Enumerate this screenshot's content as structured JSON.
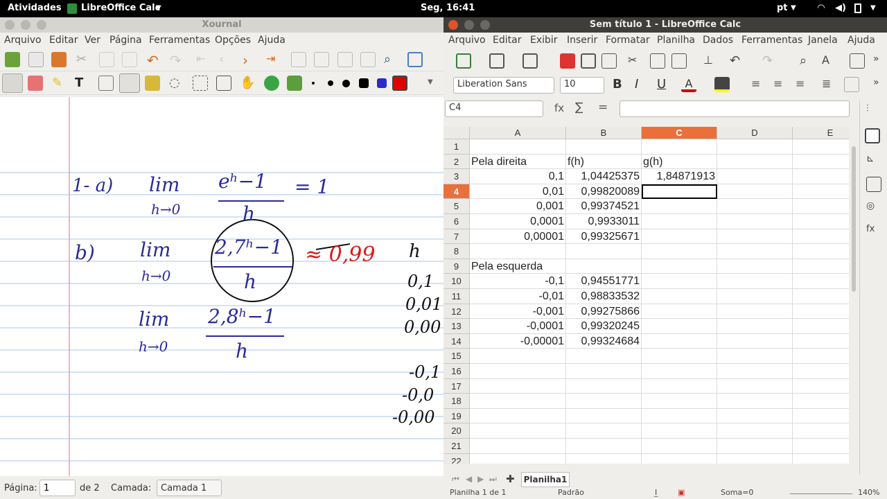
{
  "topbar": {
    "activities": "Atividades",
    "app": "LibreOffice Calc",
    "clock": "Seg, 16:41",
    "lang": "pt"
  },
  "xournal": {
    "title": "Xournal",
    "menu": [
      "Arquivo",
      "Editar",
      "Ver",
      "Página",
      "Ferramentas",
      "Opções",
      "Ajuda"
    ],
    "status": {
      "page_label": "Página:",
      "page_value": "1",
      "of_label": "de 2",
      "layer_label": "Camada:",
      "layer_value": "Camada 1"
    },
    "notes": {
      "a_label": "1- a)",
      "lim1": "lim",
      "sub1": "h→0",
      "num1": "eʰ−1",
      "den1": "h",
      "eq1": "= 1",
      "b_label": "b)",
      "lim2": "lim",
      "sub2": "h→0",
      "num2": "2,7ʰ−1",
      "den2": "h",
      "approx": "≈ 0,99",
      "lim3": "lim",
      "sub3": "h→0",
      "num3": "2,8ʰ−1",
      "den3": "h",
      "side": [
        "h",
        "0,1",
        "0,01",
        "0,00",
        "-0,1",
        "-0,0",
        "-0,00"
      ]
    }
  },
  "calc": {
    "title": "Sem título 1 - LibreOffice Calc",
    "menu": [
      "Arquivo",
      "Editar",
      "Exibir",
      "Inserir",
      "Formatar",
      "Planilha",
      "Dados",
      "Ferramentas",
      "Janela",
      "Ajuda"
    ],
    "font_name": "Liberation Sans",
    "font_size": "10",
    "name_box": "C4",
    "formula_icons": {
      "fx": "fx",
      "sum": "∑",
      "eq": "="
    },
    "columns": [
      "A",
      "B",
      "C",
      "D",
      "E"
    ],
    "rows": [
      {
        "n": "1",
        "a": "",
        "b": "",
        "c": ""
      },
      {
        "n": "2",
        "a": "Pela direita",
        "b": "f(h)",
        "c": "g(h)"
      },
      {
        "n": "3",
        "a": "0,1",
        "b": "1,04425375",
        "c": "1,84871913"
      },
      {
        "n": "4",
        "a": "0,01",
        "b": "0,99820089",
        "c": ""
      },
      {
        "n": "5",
        "a": "0,001",
        "b": "0,99374521",
        "c": ""
      },
      {
        "n": "6",
        "a": "0,0001",
        "b": "0,9933011",
        "c": ""
      },
      {
        "n": "7",
        "a": "0,00001",
        "b": "0,99325671",
        "c": ""
      },
      {
        "n": "8",
        "a": "",
        "b": "",
        "c": ""
      },
      {
        "n": "9",
        "a": "Pela esquerda",
        "b": "",
        "c": ""
      },
      {
        "n": "10",
        "a": "-0,1",
        "b": "0,94551771",
        "c": ""
      },
      {
        "n": "11",
        "a": "-0,01",
        "b": "0,98833532",
        "c": ""
      },
      {
        "n": "12",
        "a": "-0,001",
        "b": "0,99275866",
        "c": ""
      },
      {
        "n": "13",
        "a": "-0,0001",
        "b": "0,99320245",
        "c": ""
      },
      {
        "n": "14",
        "a": "-0,00001",
        "b": "0,99324684",
        "c": ""
      },
      {
        "n": "15",
        "a": "",
        "b": "",
        "c": ""
      },
      {
        "n": "16",
        "a": "",
        "b": "",
        "c": ""
      },
      {
        "n": "17",
        "a": "",
        "b": "",
        "c": ""
      },
      {
        "n": "18",
        "a": "",
        "b": "",
        "c": ""
      },
      {
        "n": "19",
        "a": "",
        "b": "",
        "c": ""
      },
      {
        "n": "20",
        "a": "",
        "b": "",
        "c": ""
      },
      {
        "n": "21",
        "a": "",
        "b": "",
        "c": ""
      },
      {
        "n": "22",
        "a": "",
        "b": "",
        "c": ""
      }
    ],
    "sheet_tab": "Planilha1",
    "status": {
      "sheet": "Planilha 1 de 1",
      "style": "Padrão",
      "sum": "Soma=0",
      "zoom": "140%"
    },
    "colors": {
      "selected_header": "#e9703b",
      "menu_bar": "#efeeeb",
      "title_bar": "#403e3a"
    }
  }
}
